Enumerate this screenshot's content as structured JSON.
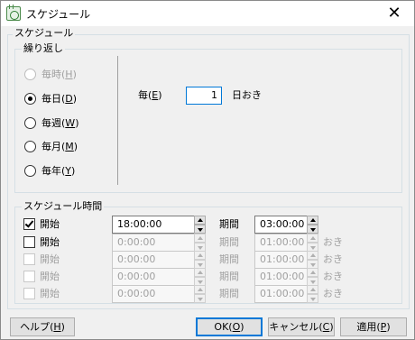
{
  "window": {
    "title": "スケジュール",
    "close_glyph": "✕"
  },
  "schedule_group": {
    "label": "スケジュール"
  },
  "repeat": {
    "label": "繰り返し",
    "options": [
      {
        "text": "毎時",
        "key": "H"
      },
      {
        "text": "毎日",
        "key": "D"
      },
      {
        "text": "毎週",
        "key": "W"
      },
      {
        "text": "毎月",
        "key": "M"
      },
      {
        "text": "毎年",
        "key": "Y"
      }
    ],
    "selected": "毎日"
  },
  "every": {
    "label": "毎",
    "key": "E",
    "value": "1",
    "suffix": "日おき"
  },
  "times": {
    "label": "スケジュール時間",
    "start_label": "開始",
    "period_label": "期間",
    "interval_suffix": "おき",
    "rows": [
      {
        "checked": true,
        "start": "18:00:00",
        "period": "03:00:00"
      },
      {
        "checked": false,
        "start": "0:00:00",
        "period": "01:00:00"
      },
      {
        "checked": false,
        "start": "0:00:00",
        "period": "01:00:00"
      },
      {
        "checked": false,
        "start": "0:00:00",
        "period": "01:00:00"
      },
      {
        "checked": false,
        "start": "0:00:00",
        "period": "01:00:00"
      }
    ]
  },
  "buttons": {
    "help": {
      "text": "ヘルプ",
      "key": "H"
    },
    "ok": {
      "text": "OK",
      "key": "O"
    },
    "cancel": {
      "text": "キャンセル",
      "key": "C"
    },
    "apply": {
      "text": "適用",
      "key": "P"
    }
  }
}
